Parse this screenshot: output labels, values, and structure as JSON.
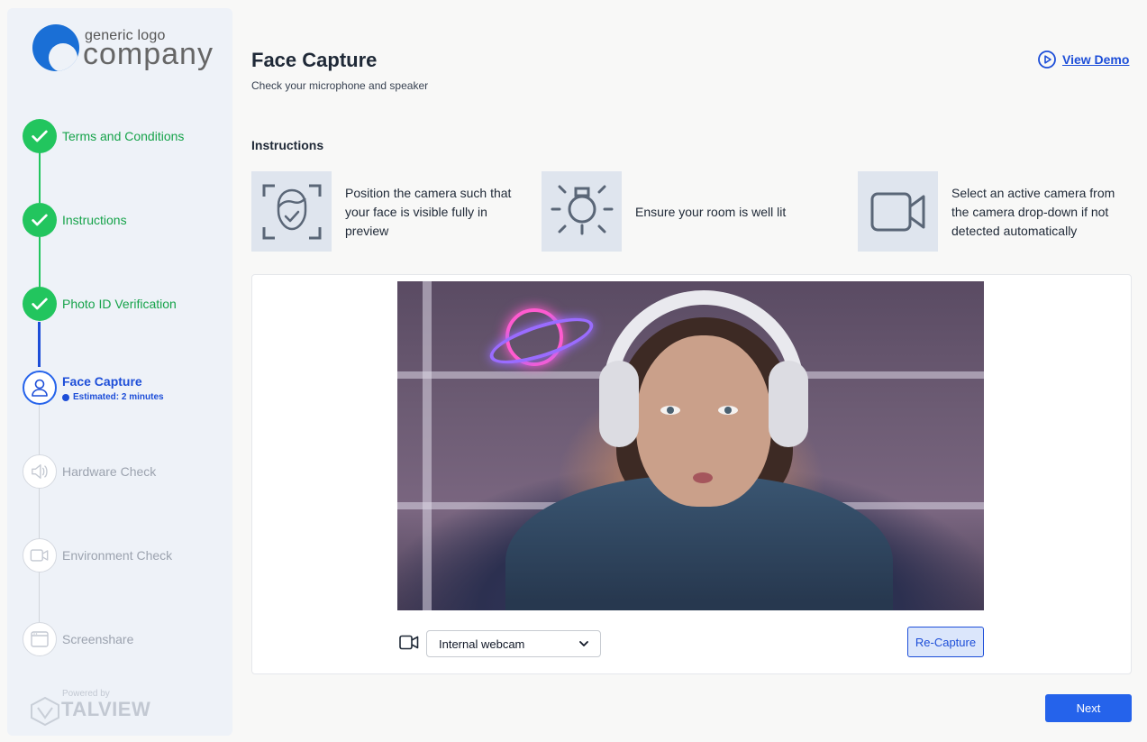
{
  "logo": {
    "small": "generic logo",
    "big": "company"
  },
  "steps": [
    {
      "label": "Terms and Conditions",
      "state": "done",
      "icon": "check-icon"
    },
    {
      "label": "Instructions",
      "state": "done",
      "icon": "check-icon"
    },
    {
      "label": "Photo ID Verification",
      "state": "done",
      "icon": "check-icon"
    },
    {
      "label": "Face Capture",
      "state": "active",
      "icon": "user-icon",
      "estimate": "Estimated: 2 minutes"
    },
    {
      "label": "Hardware Check",
      "state": "pending",
      "icon": "speaker-icon"
    },
    {
      "label": "Environment Check",
      "state": "pending",
      "icon": "video-camera-icon"
    },
    {
      "label": "Screenshare",
      "state": "pending",
      "icon": "browser-window-icon"
    }
  ],
  "powered": {
    "by": "Powered by",
    "brand": "TALVIEW"
  },
  "header": {
    "title": "Face Capture",
    "subtitle": "Check your microphone and speaker",
    "demo_label": "View Demo"
  },
  "instructions": {
    "heading": "Instructions",
    "items": [
      {
        "icon": "face-scan-icon",
        "text": "Position the camera such that your face is visible fully in preview"
      },
      {
        "icon": "light-bulb-icon",
        "text": "Ensure your room is well lit"
      },
      {
        "icon": "video-camera-icon",
        "text": "Select an active camera from the camera drop-down if not detected automatically"
      }
    ]
  },
  "camera": {
    "selected": "Internal webcam",
    "recapture_label": "Re-Capture"
  },
  "footer": {
    "next_label": "Next"
  },
  "colors": {
    "accent": "#2563eb",
    "success": "#22c55e",
    "sidebar_bg": "#eef2f8"
  }
}
